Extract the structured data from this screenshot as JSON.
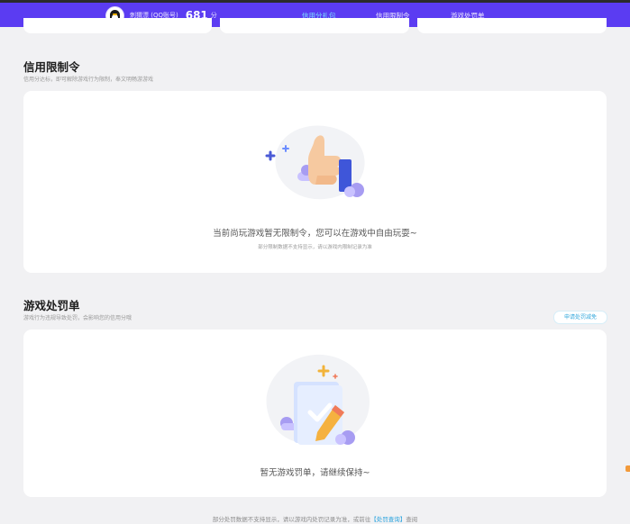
{
  "header": {
    "user_name": "刺猬漂 (QQ账号)",
    "score": "681",
    "score_unit": "分",
    "tabs": [
      {
        "label": "信用分礼包",
        "active": true
      },
      {
        "label": "信用限制令",
        "active": false
      },
      {
        "label": "游戏处罚单",
        "active": false
      }
    ]
  },
  "restriction": {
    "title": "信用限制令",
    "subtitle": "信用分达标，即可解除游戏行为限制，奉文明畅游游戏",
    "empty_text": "当前尚玩游戏暂无限制令，您可以在游戏中自由玩耍~",
    "empty_note": "部分限制数据不支持显示，请以游戏内限制记录为准"
  },
  "penalty": {
    "title": "游戏处罚单",
    "subtitle": "游戏行为违规导致处罚，会影响您的信用分哦",
    "appeal_button": "申请处罚减免",
    "empty_text": "暂无游戏罚单，请继续保持~"
  },
  "footer": {
    "text_before": "部分处罚数据不支持显示，请以游戏内处罚记录为准，或前往",
    "link_text": "【处罚查询】",
    "text_after": "查阅"
  },
  "colors": {
    "header_bg": "#5b3cf2",
    "active_tab": "#7fe3ff",
    "link": "#2aa3de",
    "page_bg": "#f1f1f3"
  },
  "icons": [
    "qq-penguin-avatar",
    "thumbs-up-illustration",
    "checklist-pencil-illustration"
  ]
}
